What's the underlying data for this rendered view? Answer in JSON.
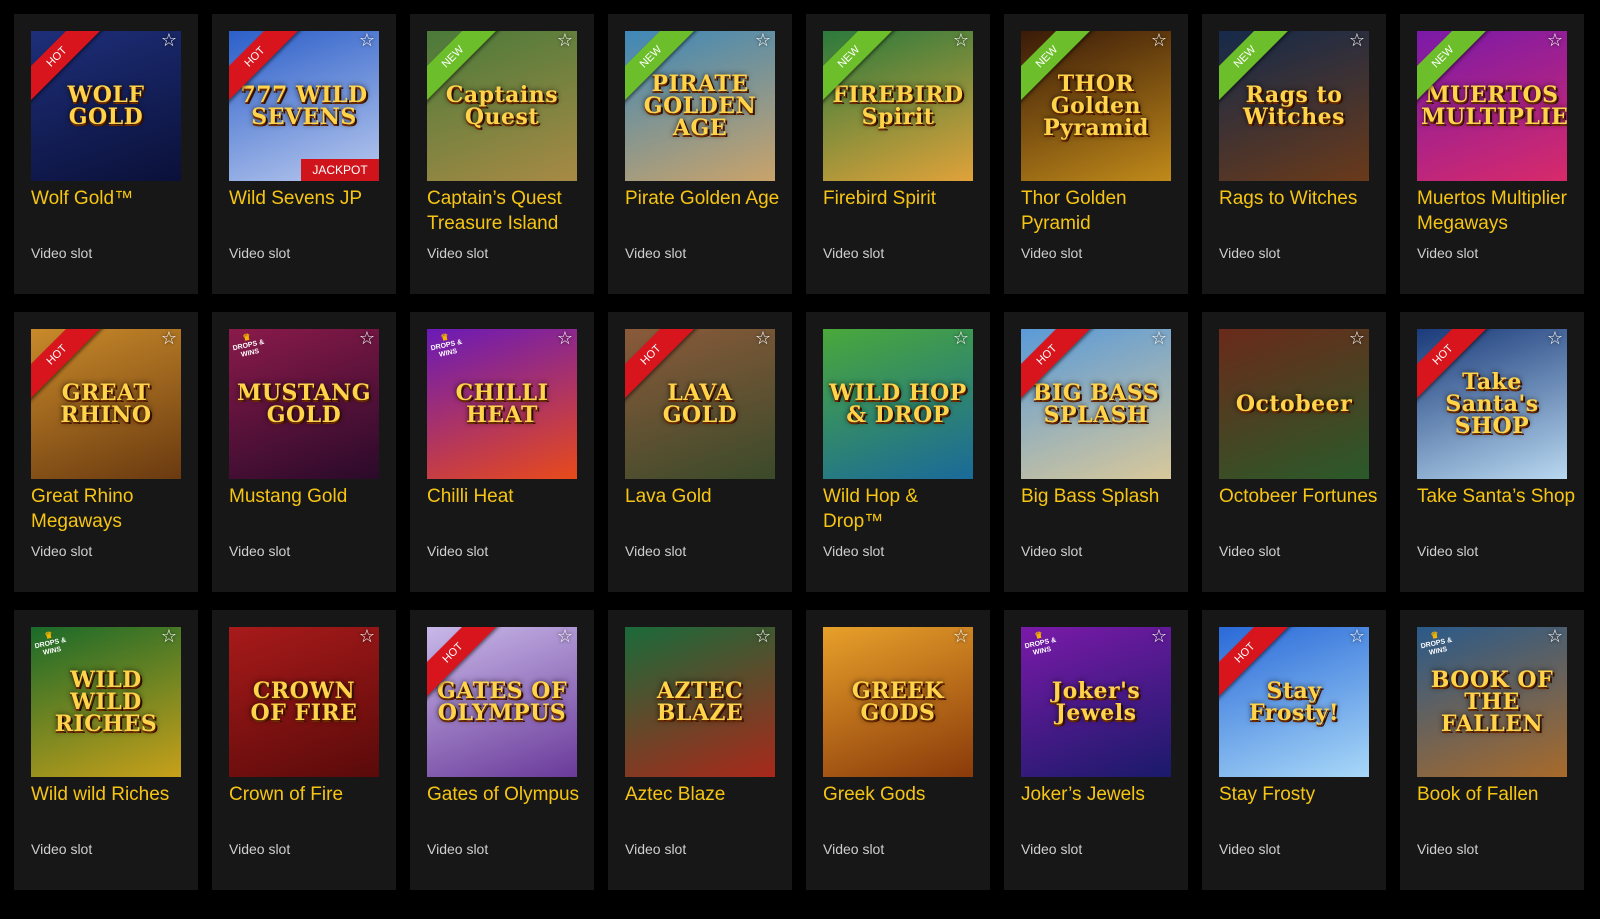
{
  "games": [
    {
      "title": "Wolf Gold™",
      "type": "Video slot",
      "badge": "HOT",
      "badge_kind": "hot",
      "art_text": "WOLF GOLD",
      "art_colors": [
        "#1e2f7a",
        "#0a1038"
      ],
      "icon": "wolf-art"
    },
    {
      "title": "Wild Sevens JP",
      "type": "Video slot",
      "badge": "HOT",
      "badge_kind": "hot",
      "art_text": "777 WILD SEVENS",
      "art_colors": [
        "#2c5fc9",
        "#b9c9ee"
      ],
      "jackpot": "JACKPOT",
      "icon": "sevens-art"
    },
    {
      "title": "Captain’s Quest Treasure Island",
      "type": "Video slot",
      "badge": "NEW",
      "badge_kind": "new",
      "art_text": "Captains Quest",
      "art_colors": [
        "#4a7a3a",
        "#a78a45"
      ],
      "icon": "captain-art"
    },
    {
      "title": "Pirate Golden Age",
      "type": "Video slot",
      "badge": "NEW",
      "badge_kind": "new",
      "art_text": "PIRATE GOLDEN AGE",
      "art_colors": [
        "#3e88b8",
        "#c9a36a"
      ],
      "icon": "pirate-art"
    },
    {
      "title": "Firebird Spirit",
      "type": "Video slot",
      "badge": "NEW",
      "badge_kind": "new",
      "art_text": "FIREBIRD Spirit",
      "art_colors": [
        "#2b7a3c",
        "#e0a23a"
      ],
      "icon": "firebird-art"
    },
    {
      "title": "Thor Golden Pyramid",
      "type": "Video slot",
      "badge": "NEW",
      "badge_kind": "new",
      "art_text": "THOR Golden Pyramid",
      "art_colors": [
        "#3a1a08",
        "#c08a1a"
      ],
      "icon": "thor-art"
    },
    {
      "title": "Rags to Witches",
      "type": "Video slot",
      "badge": "NEW",
      "badge_kind": "new",
      "art_text": "Rags to Witches",
      "art_colors": [
        "#152a4a",
        "#6a3a1a"
      ],
      "icon": "witches-art"
    },
    {
      "title": "Muertos Multiplier Megaways",
      "type": "Video slot",
      "badge": "NEW",
      "badge_kind": "new",
      "art_text": "MUERTOS MULTIPLIER",
      "art_colors": [
        "#7a1aa8",
        "#d82a6a"
      ],
      "icon": "muertos-art"
    },
    {
      "title": "Great Rhino Megaways",
      "type": "Video slot",
      "badge": "HOT",
      "badge_kind": "hot",
      "art_text": "GREAT RHINO",
      "art_colors": [
        "#c98a2a",
        "#6a3a10"
      ],
      "icon": "rhino-art"
    },
    {
      "title": "Mustang Gold",
      "type": "Video slot",
      "drops": "DROPS & WINS",
      "art_text": "MUSTANG GOLD",
      "art_colors": [
        "#8a1a4a",
        "#2a0a2a"
      ],
      "icon": "mustang-art"
    },
    {
      "title": "Chilli Heat",
      "type": "Video slot",
      "drops": "DROPS & WINS",
      "art_text": "CHILLI HEAT",
      "art_colors": [
        "#6a1ab8",
        "#e84a1a"
      ],
      "icon": "chilli-art"
    },
    {
      "title": "Lava Gold",
      "type": "Video slot",
      "badge": "HOT",
      "badge_kind": "hot",
      "art_text": "LAVA GOLD",
      "art_colors": [
        "#8a5a3a",
        "#3a4a2a"
      ],
      "icon": "lava-art"
    },
    {
      "title": "Wild Hop & Drop™",
      "type": "Video slot",
      "art_text": "WILD HOP & DROP",
      "art_colors": [
        "#4aa83a",
        "#1a6a9a"
      ],
      "icon": "frog-art"
    },
    {
      "title": "Big Bass Splash",
      "type": "Video slot",
      "badge": "HOT",
      "badge_kind": "hot",
      "art_text": "BIG BASS SPLASH",
      "art_colors": [
        "#5a9ad8",
        "#d8c89a"
      ],
      "icon": "bass-art"
    },
    {
      "title": "Octobeer Fortunes",
      "type": "Video slot",
      "art_text": "Octobeer",
      "art_colors": [
        "#6a2a1a",
        "#2a5a2a"
      ],
      "icon": "octobeer-art"
    },
    {
      "title": "Take Santa’s Shop",
      "type": "Video slot",
      "badge": "HOT",
      "badge_kind": "hot",
      "art_text": "Take Santa's SHOP",
      "art_colors": [
        "#1a3a7a",
        "#b8d8f0"
      ],
      "icon": "santa-art"
    },
    {
      "title": "Wild wild Riches",
      "type": "Video slot",
      "drops": "DROPS & WINS",
      "art_text": "WILD WILD RICHES",
      "art_colors": [
        "#1a6a2a",
        "#c8a01a"
      ],
      "icon": "riches-art"
    },
    {
      "title": "Crown of Fire",
      "type": "Video slot",
      "art_text": "CROWN OF FIRE",
      "art_colors": [
        "#a81a1a",
        "#5a0a0a"
      ],
      "icon": "crown-art"
    },
    {
      "title": "Gates of Olympus",
      "type": "Video slot",
      "badge": "HOT",
      "badge_kind": "hot",
      "art_text": "GATES OF OLYMPUS",
      "art_colors": [
        "#c8b8e8",
        "#6a3a9a"
      ],
      "icon": "olympus-art"
    },
    {
      "title": "Aztec Blaze",
      "type": "Video slot",
      "art_text": "AZTEC BLAZE",
      "art_colors": [
        "#1a6a3a",
        "#a8281a"
      ],
      "icon": "aztec-art"
    },
    {
      "title": "Greek Gods",
      "type": "Video slot",
      "art_text": "GREEK GODS",
      "art_colors": [
        "#e8a02a",
        "#8a3a0a"
      ],
      "icon": "greekgods-art"
    },
    {
      "title": "Joker’s Jewels",
      "type": "Video slot",
      "drops": "DROPS & WINS",
      "art_text": "Joker's Jewels",
      "art_colors": [
        "#7a1aa8",
        "#1a1a6a"
      ],
      "icon": "joker-art"
    },
    {
      "title": "Stay Frosty",
      "type": "Video slot",
      "badge": "HOT",
      "badge_kind": "hot",
      "art_text": "Stay Frosty!",
      "art_colors": [
        "#2a6ad8",
        "#a8d8f8"
      ],
      "icon": "frosty-art"
    },
    {
      "title": "Book of Fallen",
      "type": "Video slot",
      "drops": "DROPS & WINS",
      "art_text": "BOOK OF THE FALLEN",
      "art_colors": [
        "#2a5a8a",
        "#a86a2a"
      ],
      "icon": "book-art"
    }
  ],
  "favorite_glyph": "☆",
  "drops_crown_glyph": "♛"
}
